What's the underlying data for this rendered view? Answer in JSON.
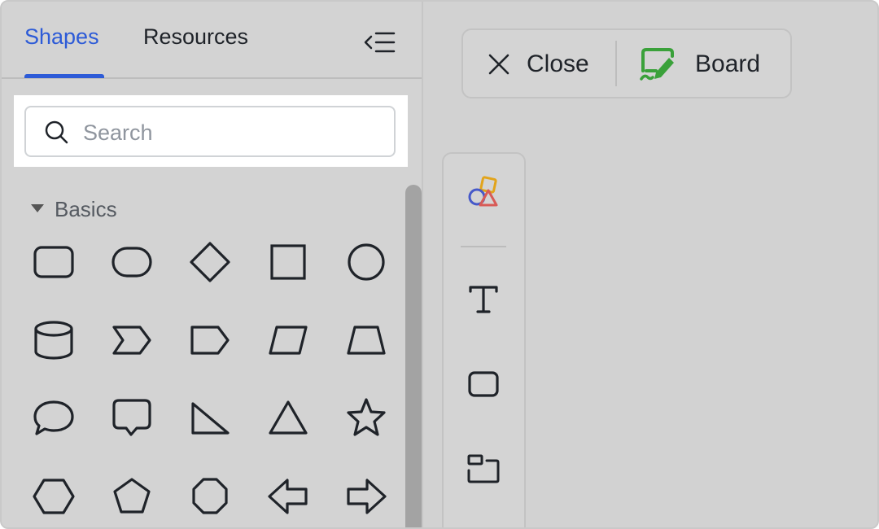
{
  "tabs": [
    {
      "label": "Shapes",
      "active": true
    },
    {
      "label": "Resources",
      "active": false
    }
  ],
  "icons": {
    "collapse": "collapse-panel-icon",
    "search": "search-icon",
    "close": "close-icon",
    "board": "board-icon",
    "shapes_tool": "shapes-icon",
    "text_tool": "text-icon",
    "rect_tool": "rectangle-icon",
    "frame_tool": "frame-icon"
  },
  "search": {
    "placeholder": "Search",
    "value": ""
  },
  "section": {
    "label": "Basics",
    "expanded": true
  },
  "shapes": [
    "rounded-rectangle",
    "stadium",
    "diamond",
    "square",
    "circle",
    "cylinder",
    "chevron",
    "pentagon-tag",
    "parallelogram",
    "trapezoid",
    "speech-bubble-oval",
    "speech-bubble-rect",
    "right-triangle",
    "triangle",
    "star",
    "hexagon",
    "pentagon",
    "octagon",
    "left-arrow",
    "right-arrow"
  ],
  "topbar": {
    "close_label": "Close",
    "board_label": "Board"
  },
  "colors": {
    "accent": "#2d5bd7",
    "board_green": "#3aa13a",
    "panel_bg": "#d3d3d3",
    "text": "#1f2329"
  }
}
